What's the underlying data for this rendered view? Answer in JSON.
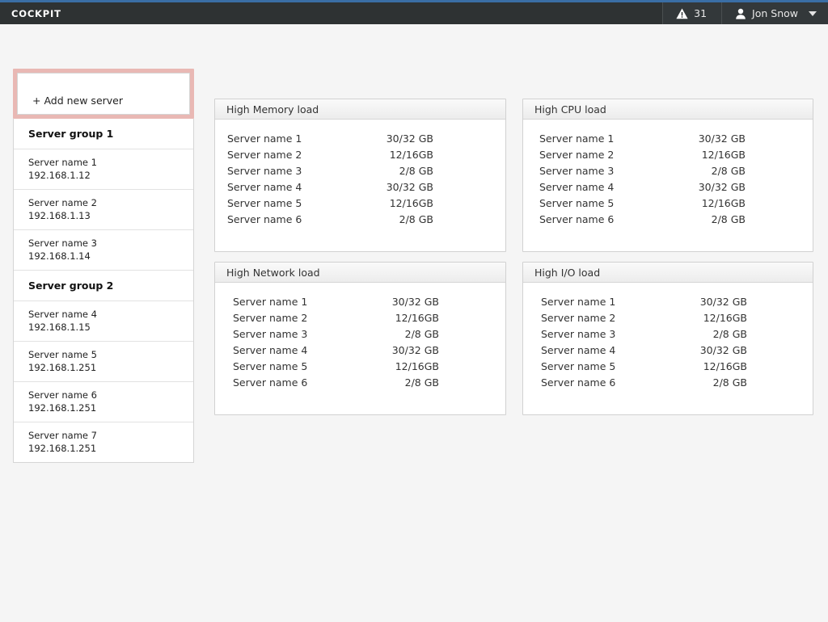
{
  "header": {
    "brand": "COCKPIT",
    "alerts": {
      "icon": "warning-triangle-icon",
      "count": "31"
    },
    "user": {
      "icon": "user-avatar-icon",
      "name": "Jon Snow",
      "caret": "chevron-down-icon"
    },
    "accent_stripe_color": "#3a6ea5",
    "background_color": "#2e3233"
  },
  "sidebar": {
    "add_server_label": "+ Add new server",
    "highlight_color": "#e9b8b4",
    "groups": [
      {
        "label": "Server group 1",
        "servers": [
          {
            "name": "Server name 1",
            "ip": "192.168.1.12"
          },
          {
            "name": "Server name 2",
            "ip": "192.168.1.13"
          },
          {
            "name": "Server name 3",
            "ip": "192.168.1.14"
          }
        ]
      },
      {
        "label": "Server group 2",
        "servers": [
          {
            "name": "Server name 4",
            "ip": "192.168.1.15"
          },
          {
            "name": "Server name 5",
            "ip": "192.168.1.251"
          },
          {
            "name": "Server name 6",
            "ip": "192.168.1.251"
          },
          {
            "name": "Server name 7",
            "ip": "192.168.1.251"
          }
        ]
      }
    ]
  },
  "cards": {
    "memory": {
      "title": "High Memory load",
      "rows": [
        {
          "name": "Server name 1",
          "value": "30/32 GB"
        },
        {
          "name": "Server name 2",
          "value": "12/16GB"
        },
        {
          "name": "Server name 3",
          "value": "2/8 GB"
        },
        {
          "name": "Server name 4",
          "value": "30/32 GB"
        },
        {
          "name": "Server name 5",
          "value": "12/16GB"
        },
        {
          "name": "Server name 6",
          "value": "2/8 GB"
        }
      ]
    },
    "cpu": {
      "title": "High CPU load",
      "rows": [
        {
          "name": "Server name 1",
          "value": "30/32 GB"
        },
        {
          "name": "Server name 2",
          "value": "12/16GB"
        },
        {
          "name": "Server name 3",
          "value": "2/8 GB"
        },
        {
          "name": "Server name 4",
          "value": "30/32 GB"
        },
        {
          "name": "Server name 5",
          "value": "12/16GB"
        },
        {
          "name": "Server name 6",
          "value": "2/8 GB"
        }
      ]
    },
    "network": {
      "title": "High Network load",
      "rows": [
        {
          "name": "Server name 1",
          "value": "30/32 GB"
        },
        {
          "name": "Server name 2",
          "value": "12/16GB"
        },
        {
          "name": "Server name 3",
          "value": "2/8 GB"
        },
        {
          "name": "Server name 4",
          "value": "30/32 GB"
        },
        {
          "name": "Server name 5",
          "value": "12/16GB"
        },
        {
          "name": "Server name 6",
          "value": "2/8 GB"
        }
      ]
    },
    "io": {
      "title": "High I/O load",
      "rows": [
        {
          "name": "Server name 1",
          "value": "30/32 GB"
        },
        {
          "name": "Server name 2",
          "value": "12/16GB"
        },
        {
          "name": "Server name 3",
          "value": "2/8 GB"
        },
        {
          "name": "Server name 4",
          "value": "30/32 GB"
        },
        {
          "name": "Server name 5",
          "value": "12/16GB"
        },
        {
          "name": "Server name 6",
          "value": "2/8 GB"
        }
      ]
    }
  }
}
